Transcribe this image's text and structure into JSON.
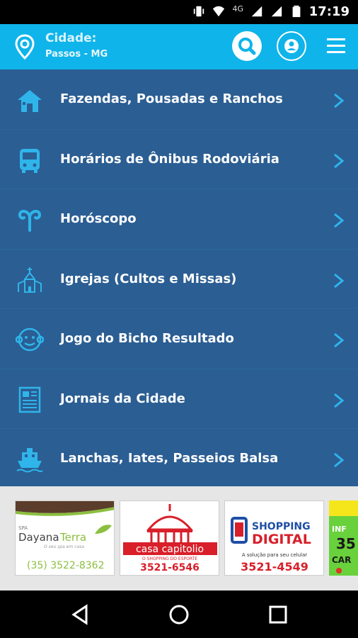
{
  "statusbar": {
    "time": "17:19",
    "network": "4G"
  },
  "header": {
    "city_label": "Cidade:",
    "city_value": "Passos - MG"
  },
  "menu": [
    {
      "label": "Fazendas, Pousadas e Ranchos",
      "icon": "house-icon"
    },
    {
      "label": "Horários de Ônibus Rodoviária",
      "icon": "bus-icon"
    },
    {
      "label": "Horóscopo",
      "icon": "aries-icon"
    },
    {
      "label": "Igrejas (Cultos e Missas)",
      "icon": "church-icon"
    },
    {
      "label": "Jogo do Bicho Resultado",
      "icon": "monkey-icon"
    },
    {
      "label": "Jornais da Cidade",
      "icon": "newspaper-icon"
    },
    {
      "label": "Lanchas, Iates, Passeios Balsa",
      "icon": "boat-icon"
    }
  ],
  "ads": [
    {
      "spa": "SPA",
      "name_a": "Dayana",
      "name_b": "Terra",
      "tagline": "O seu spa em casa",
      "phone": "(35) 3522-8362"
    },
    {
      "brand": "casa capitolio",
      "tagline": "O SHOPPING DO ESPORTE",
      "phone": "3521-6546"
    },
    {
      "brand_a": "SHOPPING",
      "brand_b": "DIGITAL",
      "tagline": "A solução para seu celular",
      "phone": "3521-4549"
    },
    {
      "line1": "INF",
      "line2": "35",
      "line3": "CAR"
    }
  ],
  "colors": {
    "header": "#0fb4ea",
    "list_bg": "#2b5e93",
    "accent": "#2fb5ea"
  }
}
